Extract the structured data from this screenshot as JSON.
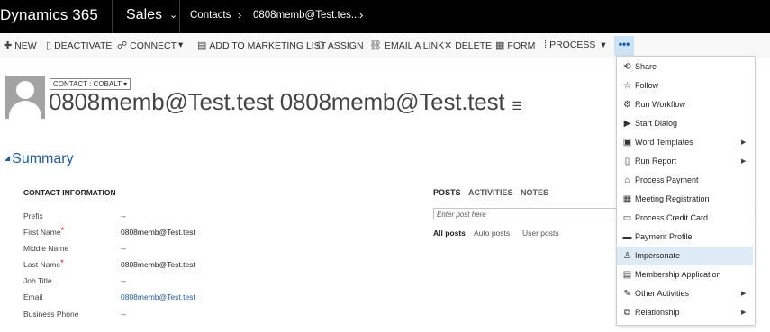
{
  "topbar": {
    "brand": "Dynamics 365",
    "area": "Sales",
    "area_chevron": "⌄",
    "breadcrumb": [
      "Contacts",
      "0808memb@Test.tes..."
    ],
    "breadcrumb_sep": "›"
  },
  "commands": {
    "new": "NEW",
    "deactivate": "DEACTIVATE",
    "connect": "CONNECT",
    "connect_more": "▾",
    "add_to_marketing_list": "ADD TO MARKETING LIST",
    "assign": "ASSIGN",
    "email_link": "EMAIL A LINK",
    "delete": "DELETE",
    "form": "FORM",
    "process": "PROCESS",
    "process_more": "▾",
    "more": "•••"
  },
  "record": {
    "form_selector": "CONTACT : COBALT ▾",
    "title": "0808memb@Test.test 0808memb@Test.test"
  },
  "summary": {
    "title": "Summary",
    "contact_header": "CONTACT INFORMATION",
    "fields": [
      {
        "label": "Prefix",
        "value": "--",
        "required": false
      },
      {
        "label": "First Name",
        "value": "0808memb@Test.test",
        "required": true
      },
      {
        "label": "Middle Name",
        "value": "--",
        "required": false
      },
      {
        "label": "Last Name",
        "value": "0808memb@Test.test",
        "required": true
      },
      {
        "label": "Job Title",
        "value": "--",
        "required": false
      },
      {
        "label": "Email",
        "value": "0808memb@Test.test",
        "required": false
      },
      {
        "label": "Business Phone",
        "value": "--",
        "required": false
      }
    ],
    "required_mark": "*"
  },
  "posts": {
    "tabs": [
      "POSTS",
      "ACTIVITIES",
      "NOTES"
    ],
    "placeholder": "Enter post here",
    "filters": [
      "All posts",
      "Auto posts",
      "User posts"
    ]
  },
  "more_menu": {
    "items": [
      {
        "label": "Share",
        "icon": "share-icon",
        "submenu": false
      },
      {
        "label": "Follow",
        "icon": "star-icon",
        "submenu": false
      },
      {
        "label": "Run Workflow",
        "icon": "workflow-icon",
        "submenu": false
      },
      {
        "label": "Start Dialog",
        "icon": "dialog-icon",
        "submenu": false
      },
      {
        "label": "Word Templates",
        "icon": "word-icon",
        "submenu": true
      },
      {
        "label": "Run Report",
        "icon": "report-icon",
        "submenu": true
      },
      {
        "label": "Process Payment",
        "icon": "payment-icon",
        "submenu": false
      },
      {
        "label": "Meeting Registration",
        "icon": "calendar-icon",
        "submenu": false
      },
      {
        "label": "Process Credit Card",
        "icon": "card-icon",
        "submenu": false
      },
      {
        "label": "Payment Profile",
        "icon": "profile-icon",
        "submenu": false
      },
      {
        "label": "Impersonate",
        "icon": "impersonate-icon",
        "submenu": false
      },
      {
        "label": "Membership Application",
        "icon": "form-icon",
        "submenu": false
      },
      {
        "label": "Other Activities",
        "icon": "activities-icon",
        "submenu": true
      },
      {
        "label": "Relationship",
        "icon": "relationship-icon",
        "submenu": true
      }
    ],
    "highlighted_index": 10,
    "submenu_arrow": "▶"
  },
  "colors": {
    "topbar": "#000000",
    "accent": "#1a5ea8",
    "highlight": "#ddebf7",
    "required": "#d30000"
  }
}
